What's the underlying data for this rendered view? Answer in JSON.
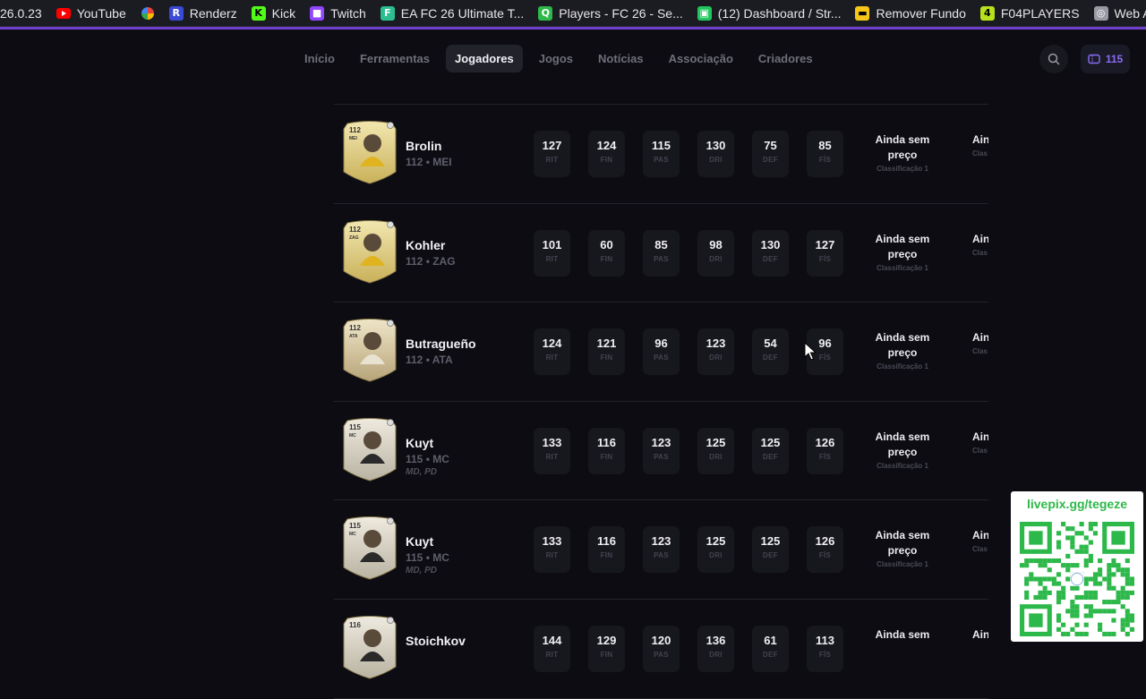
{
  "bookmarks": [
    {
      "label": "26.0.23",
      "icon": "none"
    },
    {
      "label": "YouTube",
      "icon": "youtube-icon",
      "color": "#ff0000"
    },
    {
      "label": "",
      "icon": "pinwheel-icon",
      "color": "#f2a93b"
    },
    {
      "label": "Renderz",
      "icon": "renderz-icon",
      "glyph": "R",
      "color": "#3a4ad6"
    },
    {
      "label": "Kick",
      "icon": "kick-icon",
      "glyph": "K",
      "color": "#53fc18"
    },
    {
      "label": "Twitch",
      "icon": "twitch-icon",
      "glyph": "■",
      "color": "#9146ff"
    },
    {
      "label": "EA FC 26 Ultimate T...",
      "icon": "futbin-icon",
      "glyph": "F",
      "color": "#2bbf8f"
    },
    {
      "label": "Players - FC 26 - Se...",
      "icon": "q-icon",
      "glyph": "Q",
      "color": "#2eb84a"
    },
    {
      "label": "(12) Dashboard / Str...",
      "icon": "dashboard-icon",
      "glyph": "▣",
      "color": "#22c55e"
    },
    {
      "label": "Remover Fundo",
      "icon": "remover-icon",
      "glyph": "▬",
      "color": "#f5c518"
    },
    {
      "label": "F04PLAYERS",
      "icon": "f04-icon",
      "glyph": "4",
      "color": "#b7e11c"
    },
    {
      "label": "Web Ap",
      "icon": "globe-icon",
      "glyph": "◎",
      "color": "#9a9aa5"
    }
  ],
  "nav": {
    "tabs": [
      "Início",
      "Ferramentas",
      "Jogadores",
      "Jogos",
      "Notícias",
      "Associação",
      "Criadores"
    ],
    "active_index": 2,
    "coins": "115"
  },
  "stat_labels": [
    "RIT",
    "FIN",
    "PAS",
    "DRI",
    "DEF",
    "FÍS"
  ],
  "players": [
    {
      "name": "Brolin",
      "meta": "112 • MEI",
      "alt": "",
      "stats": [
        "127",
        "124",
        "115",
        "130",
        "75",
        "85"
      ],
      "price": "Ainda sem preço",
      "rank": "Classificação 1",
      "price2": "Ain p",
      "rank2": "Clas",
      "rating": "112",
      "pos": "MEI"
    },
    {
      "name": "Kohler",
      "meta": "112 • ZAG",
      "alt": "",
      "stats": [
        "101",
        "60",
        "85",
        "98",
        "130",
        "127"
      ],
      "price": "Ainda sem preço",
      "rank": "Classificação 1",
      "price2": "Ain p",
      "rank2": "Clas",
      "rating": "112",
      "pos": "ZAG"
    },
    {
      "name": "Butragueño",
      "meta": "112 • ATA",
      "alt": "",
      "stats": [
        "124",
        "121",
        "96",
        "123",
        "54",
        "96"
      ],
      "price": "Ainda sem preço",
      "rank": "Classificação 1",
      "price2": "Ain p",
      "rank2": "Clas",
      "rating": "112",
      "pos": "ATA"
    },
    {
      "name": "Kuyt",
      "meta": "115 • MC",
      "alt": "MD, PD",
      "stats": [
        "133",
        "116",
        "123",
        "125",
        "125",
        "126"
      ],
      "price": "Ainda sem preço",
      "rank": "Classificação 1",
      "price2": "Ain p",
      "rank2": "Clas",
      "rating": "115",
      "pos": "MC"
    },
    {
      "name": "Kuyt",
      "meta": "115 • MC",
      "alt": "MD, PD",
      "stats": [
        "133",
        "116",
        "123",
        "125",
        "125",
        "126"
      ],
      "price": "Ainda sem preço",
      "rank": "Classificação 1",
      "price2": "Ain p",
      "rank2": "Clas",
      "rating": "115",
      "pos": "MC"
    },
    {
      "name": "Stoichkov",
      "meta": "",
      "alt": "",
      "stats": [
        "144",
        "129",
        "120",
        "136",
        "61",
        "113"
      ],
      "price": "Ainda sem",
      "rank": "",
      "price2": "Ain",
      "rank2": "",
      "rating": "116",
      "pos": ""
    }
  ],
  "qr": {
    "title": "livepix.gg/tegeze"
  }
}
